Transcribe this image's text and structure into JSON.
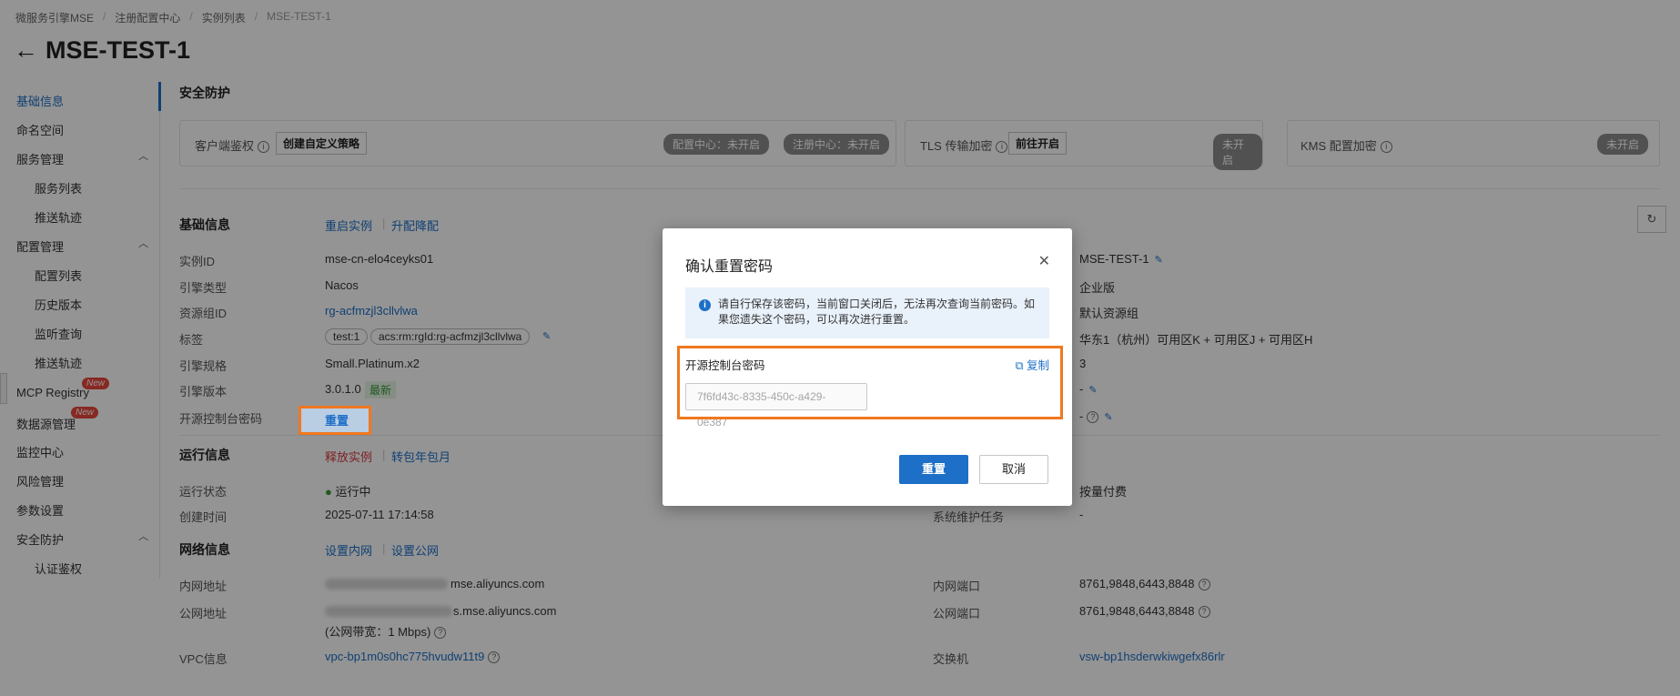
{
  "breadcrumb": [
    "微服务引擎MSE",
    "注册配置中心",
    "实例列表",
    "MSE-TEST-1"
  ],
  "page_title": "MSE-TEST-1",
  "sidebar": {
    "items": [
      {
        "label": "基础信息"
      },
      {
        "label": "命名空间"
      },
      {
        "label": "服务管理"
      },
      {
        "label": "服务列表"
      },
      {
        "label": "推送轨迹"
      },
      {
        "label": "配置管理"
      },
      {
        "label": "配置列表"
      },
      {
        "label": "历史版本"
      },
      {
        "label": "监听查询"
      },
      {
        "label": "推送轨迹"
      },
      {
        "label": "MCP Registry"
      },
      {
        "label": "数据源管理"
      },
      {
        "label": "监控中心"
      },
      {
        "label": "风险管理"
      },
      {
        "label": "参数设置"
      },
      {
        "label": "安全防护"
      },
      {
        "label": "认证鉴权"
      }
    ],
    "new_badge": "New"
  },
  "security": {
    "title": "安全防护",
    "client_auth": "客户端鉴权",
    "create_policy": "创建自定义策略",
    "config_center": "配置中心：未开启",
    "registry_center": "注册中心：未开启",
    "tls": "TLS 传输加密",
    "enable_now": "前往开启",
    "tls_status": "未开启",
    "kms": "KMS 配置加密",
    "kms_status": "未开启"
  },
  "basic": {
    "title": "基础信息",
    "restart": "重启实例",
    "upgrade": "升配降配",
    "rows": [
      {
        "label": "实例ID",
        "value": "mse-cn-elo4ceyks01"
      },
      {
        "label": "引擎类型",
        "value": "Nacos"
      },
      {
        "label": "资源组ID",
        "value": "rg-acfmzjl3cllvlwa"
      },
      {
        "label": "标签",
        "value": ""
      },
      {
        "label": "引擎规格",
        "value": "Small.Platinum.x2"
      },
      {
        "label": "引擎版本",
        "value": "3.0.1.0"
      },
      {
        "label": "开源控制台密码",
        "value": "重置"
      }
    ],
    "tags": [
      "test:1",
      "acs:rm:rgId:rg-acfmzjl3cllvlwa"
    ],
    "latest": "最新",
    "right_values": [
      "MSE-TEST-1",
      "企业版",
      "默认资源组",
      "华东1（杭州）可用区K + 可用区J + 可用区H",
      "3",
      "-",
      "-"
    ]
  },
  "runtime": {
    "title": "运行信息",
    "release": "释放实例",
    "convert": "转包年包月",
    "status_label": "运行状态",
    "status_value": "运行中",
    "created_label": "创建时间",
    "created_value": "2025-07-11 17:14:58",
    "pay_value": "按量付费",
    "maintain_label": "系统维护任务",
    "maintain_value": "-"
  },
  "network": {
    "title": "网络信息",
    "set_private": "设置内网",
    "set_public": "设置公网",
    "private_addr_label": "内网地址",
    "private_addr_suffix": "mse.aliyuncs.com",
    "public_addr_label": "公网地址",
    "public_addr_suffix": "s.mse.aliyuncs.com",
    "bandwidth": "(公网带宽：1 Mbps)",
    "vpc_label": "VPC信息",
    "vpc_value": "vpc-bp1m0s0hc775hvudw11t9",
    "private_port_label": "内网端口",
    "private_port_value": "8761,9848,6443,8848",
    "public_port_label": "公网端口",
    "public_port_value": "8761,9848,6443,8848",
    "vswitch_label": "交换机",
    "vswitch_value": "vsw-bp1hsderwkiwgefx86rlr"
  },
  "dialog": {
    "title": "确认重置密码",
    "notice": "请自行保存该密码，当前窗口关闭后，无法再次查询当前密码。如果您遗失这个密码，可以再次进行重置。",
    "pw_label": "开源控制台密码",
    "copy": "复制",
    "pw_value": "7f6fd43c-8335-450c-a429-0e387",
    "confirm": "重置",
    "cancel": "取消"
  },
  "colors": {
    "accent": "#1d6fc7",
    "highlight": "#f07820",
    "danger": "#e8463c"
  }
}
